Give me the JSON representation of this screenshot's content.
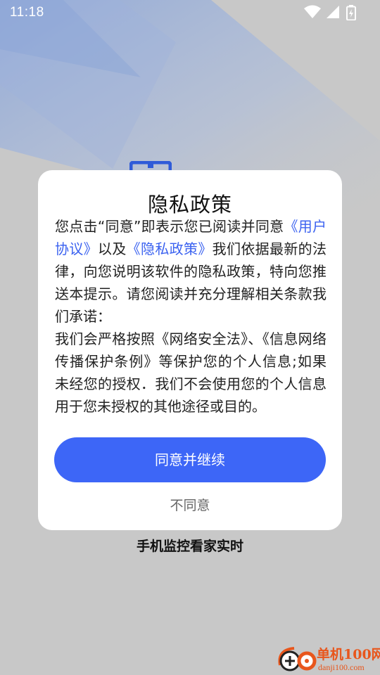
{
  "status_bar": {
    "time": "11:18",
    "icons": [
      "wifi-icon",
      "signal-icon",
      "battery-icon"
    ]
  },
  "dialog": {
    "title": "隐私政策",
    "body": {
      "intro_prefix": "您点击“同意”即表示您已阅读并同意",
      "user_agreement_link": "《用户协议》",
      "and_text": "以及",
      "privacy_policy_link": "《隐私政策》",
      "intro_suffix": "我们依据最新的法律，向您说明该软件的隐私政策，特向您推送本提示。请您阅读并充分理解相关条款我们承诺：",
      "commitment": "我们会严格按照《网络安全法》、《信息网络传播保护条例》等保护您的个人信息;如果未经您的授权．我们不会使用您的个人信息用于您未授权的其他途径或目的。"
    },
    "agree_button_label": "同意并继续",
    "disagree_button_label": "不同意"
  },
  "slogan": "手机监控看家实时",
  "watermark": {
    "name": "单机100网",
    "url": "danji100.com"
  },
  "colors": {
    "background": "#c8c8c8",
    "accent": "#3d66f7",
    "link": "#3b62f0",
    "watermark": "#e8561c"
  }
}
